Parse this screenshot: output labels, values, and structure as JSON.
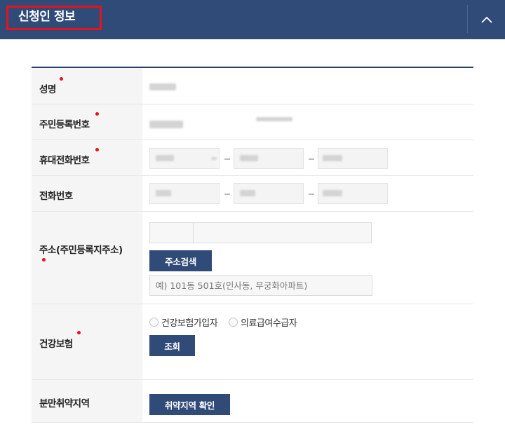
{
  "header": {
    "title": "신청인 정보",
    "collapse_icon": "chevron-up-icon"
  },
  "colors": {
    "navy": "#314b78",
    "required_dot": "#e3141f",
    "highlight_border": "#e3141f"
  },
  "form": {
    "rows": [
      {
        "label": "성명",
        "required": true
      },
      {
        "label": "주민등록번호",
        "required": true
      },
      {
        "label": "휴대전화번호",
        "required": true
      },
      {
        "label": "전화번호",
        "required": false
      },
      {
        "label": "주소(주민등록지주소)",
        "required": true
      },
      {
        "label": "건강보험",
        "required": true
      },
      {
        "label": "분만취약지역",
        "required": false
      }
    ],
    "address": {
      "search_button": "주소검색",
      "detail_placeholder": "예) 101동 501호(인사동, 무궁화아파트)"
    },
    "insurance": {
      "options": [
        "건강보험가입자",
        "의료급여수급자"
      ],
      "lookup_button": "조회"
    },
    "vulnerable_area": {
      "check_button": "취약지역 확인"
    }
  }
}
